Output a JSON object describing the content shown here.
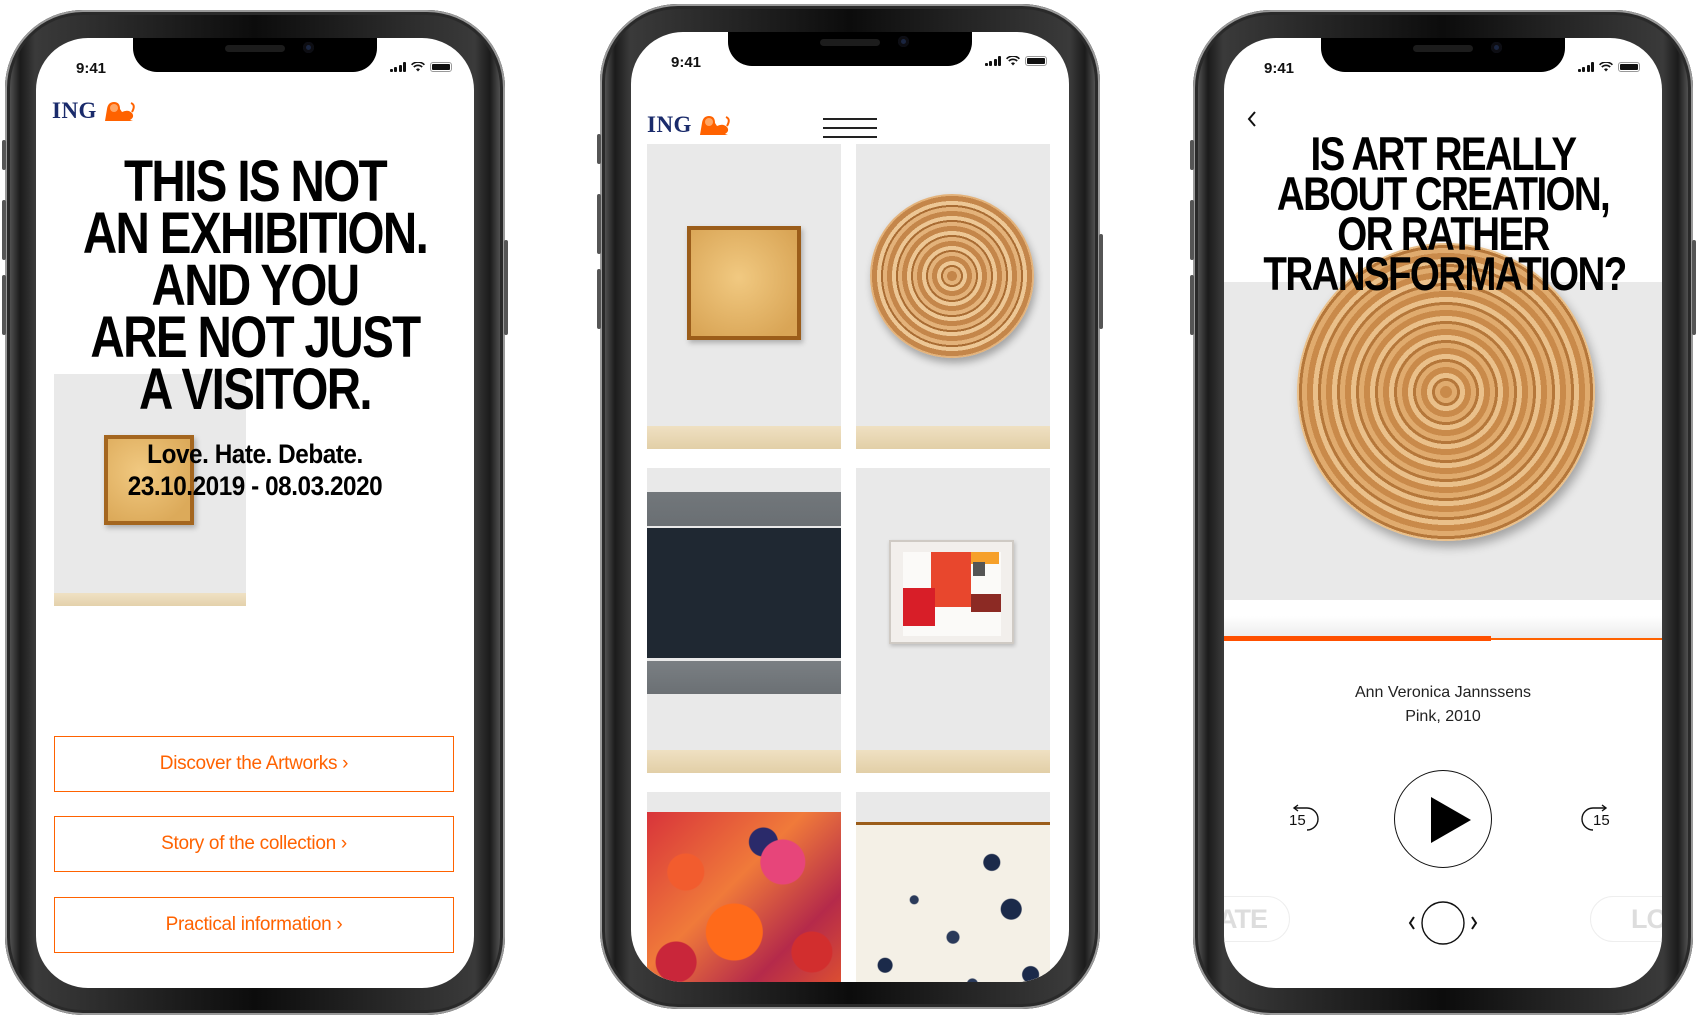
{
  "status_bar": {
    "time": "9:41"
  },
  "brand": {
    "logo_text": "ING",
    "logo_icon": "lion-icon",
    "primary_color": "#ff6200",
    "navy_color": "#1a2b6b"
  },
  "home_screen": {
    "headline": [
      "THIS IS NOT",
      "AN EXHIBITION.",
      "AND YOU",
      "ARE NOT JUST",
      "A VISITOR."
    ],
    "tagline": "Love. Hate. Debate.",
    "dates": "23.10.2019 - 08.03.2020",
    "buttons": [
      {
        "label": "Discover the Artworks ›"
      },
      {
        "label": "Story of the collection ›"
      },
      {
        "label": "Practical information ›"
      }
    ]
  },
  "gallery_screen": {
    "menu_icon": "hamburger-icon",
    "artworks": [
      {
        "name": "golden-square-canvas"
      },
      {
        "name": "woven-round-disc"
      },
      {
        "name": "dark-blue-gray-stripes"
      },
      {
        "name": "red-textile-collage"
      },
      {
        "name": "expressionist-red-figures"
      },
      {
        "name": "blue-ink-splatter"
      }
    ]
  },
  "player_screen": {
    "back_icon": "chevron-left-icon",
    "question": [
      "IS ART REALLY",
      "ABOUT CREATION,",
      "OR RATHER",
      "TRANSFORMATION?"
    ],
    "progress": 0.61,
    "artist": "Ann Veronica Jannssens",
    "artwork_title": "Pink, 2010",
    "rewind_label": "15",
    "forward_label": "15",
    "reaction_left": "HATE",
    "reaction_right": "LOVE"
  }
}
